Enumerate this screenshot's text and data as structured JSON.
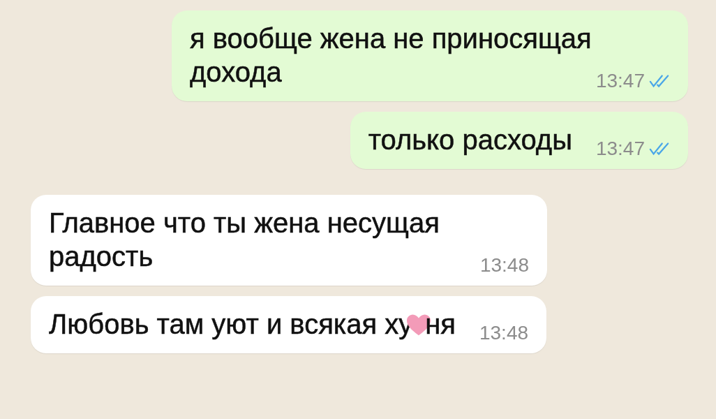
{
  "messages": [
    {
      "kind": "outgoing",
      "parts": [
        {
          "kind": "text",
          "text": "я вообще жена не приносящая дохода"
        }
      ],
      "time": "13:47",
      "read": true
    },
    {
      "kind": "outgoing",
      "parts": [
        {
          "kind": "text",
          "text": "только расходы"
        }
      ],
      "time": "13:47",
      "read": true
    },
    {
      "kind": "incoming",
      "parts": [
        {
          "kind": "text",
          "text": "Главное что ты жена несущая радость"
        }
      ],
      "time": "13:48"
    },
    {
      "kind": "incoming",
      "parts": [
        {
          "kind": "text",
          "text": "Любовь там уют и всякая ху"
        },
        {
          "kind": "heart"
        },
        {
          "kind": "text",
          "text": "ня"
        }
      ],
      "time": "13:48"
    }
  ]
}
